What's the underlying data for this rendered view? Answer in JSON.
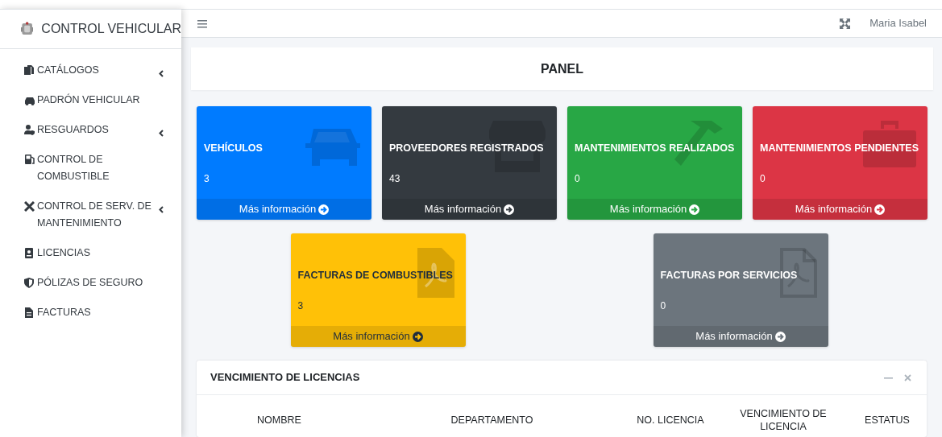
{
  "brand": {
    "title": "CONTROL VEHICULAR"
  },
  "navbar": {
    "user": "Maria Isabel"
  },
  "sidebar": {
    "items": [
      {
        "label": "CATÁLOGOS",
        "has_submenu": true
      },
      {
        "label": "PADRÓN VEHICULAR",
        "has_submenu": false
      },
      {
        "label": "RESGUARDOS",
        "has_submenu": true
      },
      {
        "label": "CONTROL DE COMBUSTIBLE",
        "has_submenu": false
      },
      {
        "label": "CONTROL DE SERV. DE MANTENIMIENTO",
        "has_submenu": true
      },
      {
        "label": "LICENCIAS",
        "has_submenu": false
      },
      {
        "label": "PÓLIZAS DE SEGURO",
        "has_submenu": false
      },
      {
        "label": "FACTURAS",
        "has_submenu": false
      }
    ]
  },
  "page": {
    "title": "PANEL"
  },
  "cards": [
    {
      "title": "VEHÍCULOS",
      "count": "3",
      "link": "Más información",
      "color": "#007bff",
      "dark_text": false
    },
    {
      "title": "PROVEEDORES REGISTRADOS",
      "count": "43",
      "link": "Más información",
      "color": "#343a40",
      "dark_text": false
    },
    {
      "title": "MANTENIMIENTOS REALIZADOS",
      "count": "0",
      "link": "Más información",
      "color": "#28a745",
      "dark_text": false
    },
    {
      "title": "MANTENIMIENTOS PENDIENTES",
      "count": "0",
      "link": "Más información",
      "color": "#dc3545",
      "dark_text": false
    },
    {
      "title": "FACTURAS DE COMBUSTIBLES",
      "count": "3",
      "link": "Más información",
      "color": "#ffc107",
      "dark_text": true
    },
    {
      "title": "FACTURAS POR SERVICIOS",
      "count": "0",
      "link": "Más información",
      "color": "#6c757d",
      "dark_text": false
    }
  ],
  "licenses": {
    "title": "VENCIMIENTO DE LICENCIAS",
    "columns": [
      "NOMBRE",
      "DEPARTAMENTO",
      "NO. LICENCIA",
      "VENCIMIENTO DE LICENCIA",
      "ESTATUS"
    ]
  }
}
